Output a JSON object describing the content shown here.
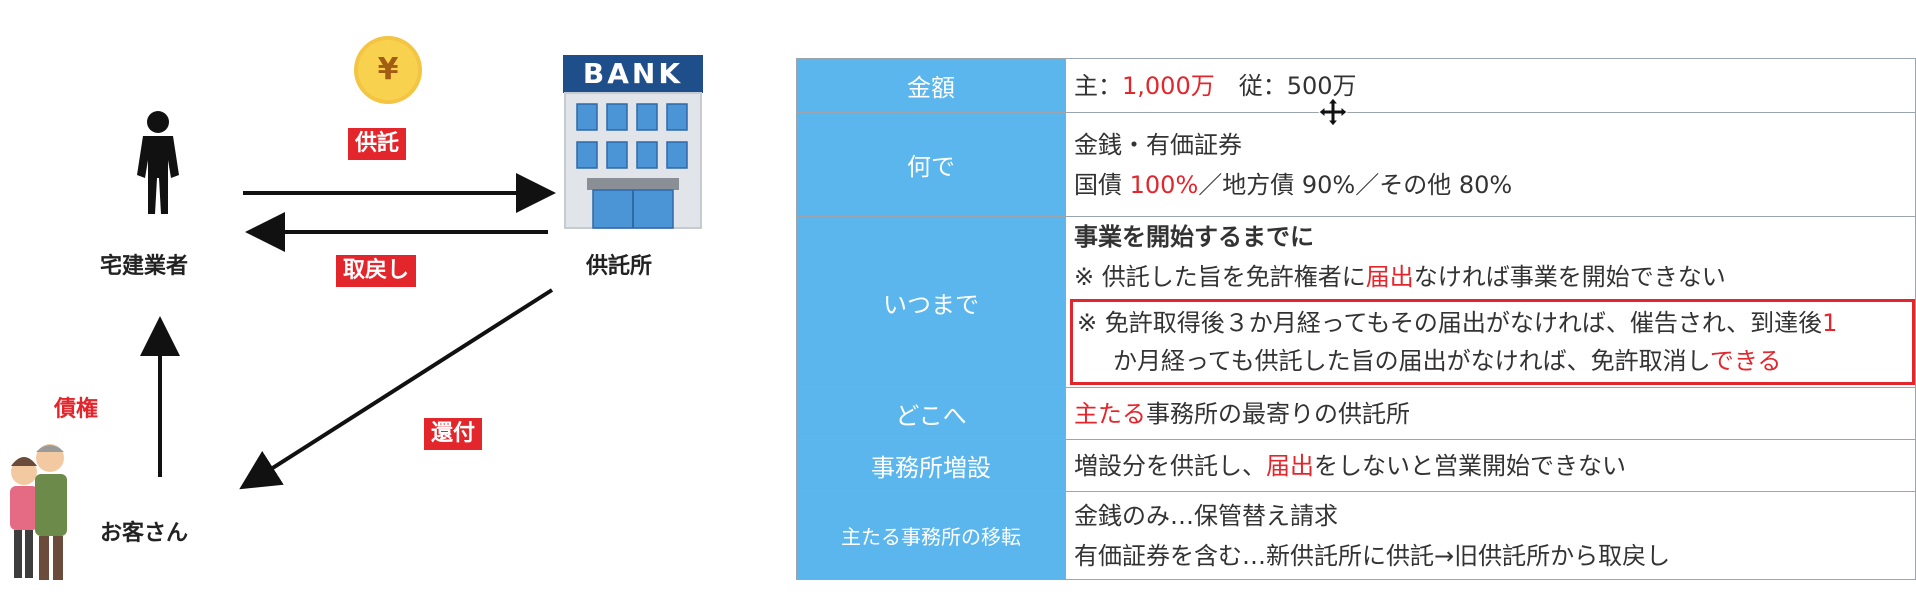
{
  "diagram": {
    "gyousha_label": "宅建業者",
    "bank_sign": "BANK",
    "kyotakusho_label": "供託所",
    "customer_label": "お客さん",
    "kyotaku_tag": "供託",
    "torimodoshi_tag": "取戻し",
    "kanpu_tag": "還付",
    "saiken_label": "債権",
    "yen_symbol": "¥"
  },
  "table": {
    "rows": [
      {
        "header": "金額",
        "main_label": "主：",
        "main_value": "1,000万",
        "sub_text": "従：500万"
      },
      {
        "header": "何で",
        "line1": "金銭・有価証券",
        "line2_a": "国債 ",
        "line2_b": "100%",
        "line2_c": "／地方債 90%／その他 80%"
      },
      {
        "header": "いつまで",
        "line1": "事業を開始するまでに",
        "line2_a": "※ 供託した旨を免許権者に",
        "line2_b": "届出",
        "line2_c": "なければ事業を開始できない",
        "box_line1_a": "※ 免許取得後３か月経ってもその届出がなければ、催告され、到達後",
        "box_line1_b": "1",
        "box_line2_a": "か月経っても供託した旨の届出がなければ、免許取消し",
        "box_line2_b": "できる"
      },
      {
        "header": "どこへ",
        "text_a": "主たる",
        "text_b": "事務所の最寄りの供託所"
      },
      {
        "header": "事務所増設",
        "text_a": "増設分を供託し、",
        "text_b": "届出",
        "text_c": "をしないと営業開始できない"
      },
      {
        "header": "主たる事務所の移転",
        "line1": "金銭のみ…保管替え請求",
        "line2": "有価証券を含む…新供託所に供託→旧供託所から取戻し"
      }
    ]
  }
}
